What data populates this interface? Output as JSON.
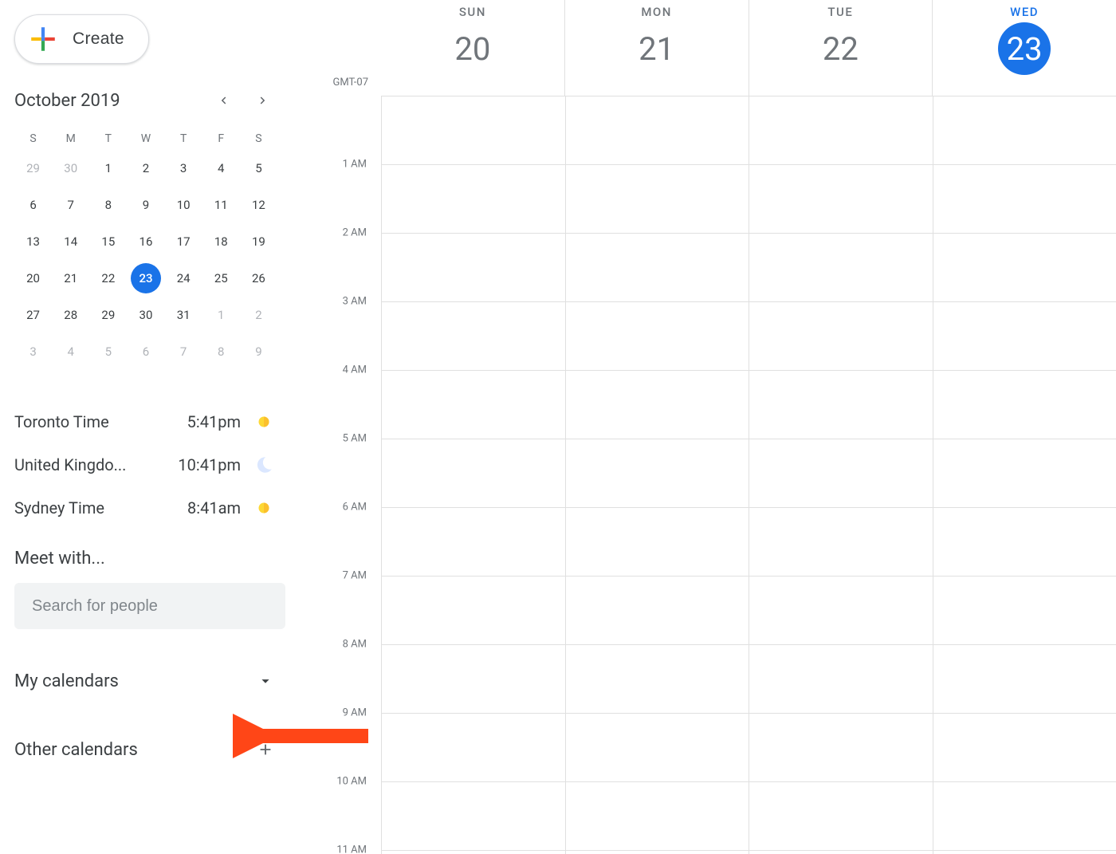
{
  "create_label": "Create",
  "month_title": "October 2019",
  "mini_cal": {
    "dow": [
      "S",
      "M",
      "T",
      "W",
      "T",
      "F",
      "S"
    ],
    "weeks": [
      [
        {
          "d": 29,
          "o": true
        },
        {
          "d": 30,
          "o": true
        },
        {
          "d": 1
        },
        {
          "d": 2
        },
        {
          "d": 3
        },
        {
          "d": 4
        },
        {
          "d": 5
        }
      ],
      [
        {
          "d": 6
        },
        {
          "d": 7
        },
        {
          "d": 8
        },
        {
          "d": 9
        },
        {
          "d": 10
        },
        {
          "d": 11
        },
        {
          "d": 12
        }
      ],
      [
        {
          "d": 13
        },
        {
          "d": 14
        },
        {
          "d": 15
        },
        {
          "d": 16
        },
        {
          "d": 17
        },
        {
          "d": 18
        },
        {
          "d": 19
        }
      ],
      [
        {
          "d": 20
        },
        {
          "d": 21
        },
        {
          "d": 22
        },
        {
          "d": 23,
          "today": true
        },
        {
          "d": 24
        },
        {
          "d": 25
        },
        {
          "d": 26
        }
      ],
      [
        {
          "d": 27
        },
        {
          "d": 28
        },
        {
          "d": 29
        },
        {
          "d": 30
        },
        {
          "d": 31
        },
        {
          "d": 1,
          "o": true
        },
        {
          "d": 2,
          "o": true
        }
      ],
      [
        {
          "d": 3,
          "o": true
        },
        {
          "d": 4,
          "o": true
        },
        {
          "d": 5,
          "o": true
        },
        {
          "d": 6,
          "o": true
        },
        {
          "d": 7,
          "o": true
        },
        {
          "d": 8,
          "o": true
        },
        {
          "d": 9,
          "o": true
        }
      ]
    ]
  },
  "clocks": [
    {
      "name": "Toronto Time",
      "time": "5:41pm",
      "icon": "sun"
    },
    {
      "name": "United Kingdo...",
      "time": "10:41pm",
      "icon": "moon"
    },
    {
      "name": "Sydney Time",
      "time": "8:41am",
      "icon": "sun"
    }
  ],
  "meet_heading": "Meet with...",
  "search_placeholder": "Search for people",
  "lists": {
    "my_calendars": "My calendars",
    "other_calendars": "Other calendars"
  },
  "timezone": "GMT-07",
  "day_headers": [
    {
      "dow": "SUN",
      "num": "20",
      "today": false
    },
    {
      "dow": "MON",
      "num": "21",
      "today": false
    },
    {
      "dow": "TUE",
      "num": "22",
      "today": false
    },
    {
      "dow": "WED",
      "num": "23",
      "today": true
    }
  ],
  "hours": [
    "1 AM",
    "2 AM",
    "3 AM",
    "4 AM",
    "5 AM",
    "6 AM",
    "7 AM",
    "8 AM",
    "9 AM",
    "10 AM",
    "11 AM"
  ]
}
